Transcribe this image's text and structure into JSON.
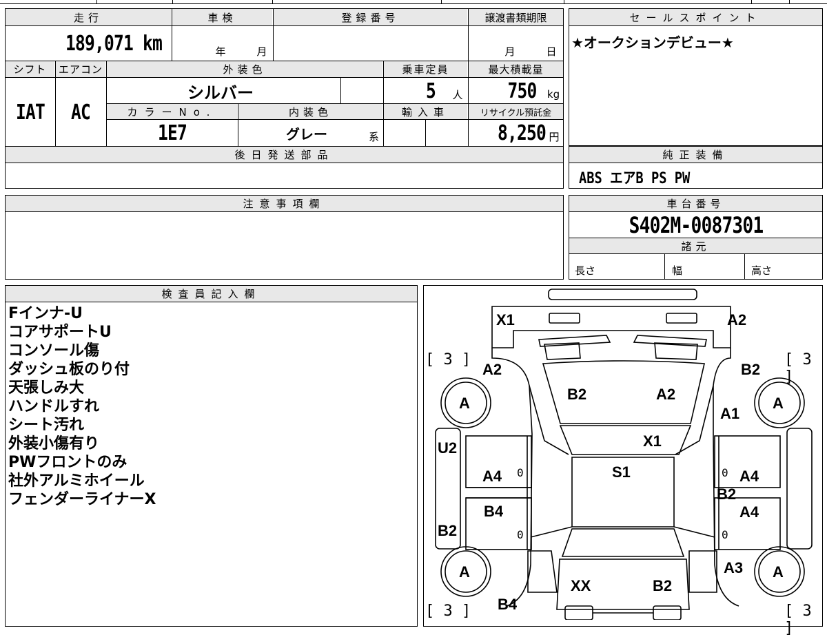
{
  "vehicle": {
    "mileage_label": "走行",
    "mileage_value": "189,071 km",
    "inspection_label": "車検",
    "inspection_year": "年",
    "inspection_month": "月",
    "registration_label": "登録番号",
    "registration_value": "",
    "transfer_label": "譲渡書類期限",
    "transfer_month": "月",
    "transfer_day": "日",
    "shift_label": "シフト",
    "shift_value": "IAT",
    "aircon_label": "エアコン",
    "aircon_value": "AC",
    "exterior_label": "外装色",
    "exterior_value": "シルバー",
    "capacity_label": "乗車定員",
    "capacity_value": "5",
    "capacity_unit": "人",
    "maxload_label": "最大積載量",
    "maxload_value": "750",
    "maxload_unit": "kg",
    "colorno_label": "カラーNo.",
    "colorno_value": "1E7",
    "interior_label": "内装色",
    "interior_value": "グレー",
    "interior_suffix": "系",
    "import_label": "輸入車",
    "recycle_label": "リサイクル預託金",
    "recycle_value": "8,250",
    "recycle_unit": "円",
    "later_parts_label": "後日発送部品"
  },
  "sales": {
    "label": "セールスポイント",
    "text": "★オークションデビュー★"
  },
  "equipment": {
    "label": "純正装備",
    "text": "ABS エアB PS PW"
  },
  "caution": {
    "label": "注意事項欄"
  },
  "chassis": {
    "label": "車台番号",
    "value": "S402M-0087301",
    "specs_label": "諸元",
    "length_label": "長さ",
    "width_label": "幅",
    "height_label": "高さ"
  },
  "inspector": {
    "label": "検査員記入欄",
    "notes": [
      "Fインナ-U",
      "コアサポートU",
      "コンソール傷",
      "ダッシュ板のり付",
      "天張しみ大",
      "ハンドルすれ",
      "シート汚れ",
      "外装小傷有り",
      "PWフロントのみ",
      "社外アルミホイール",
      "フェンダーライナーX"
    ]
  },
  "diagram": {
    "labels": {
      "front_left": "X1",
      "front_right": "A2",
      "fender_left": "A2",
      "fender_right": "B2",
      "hood_left": "B2",
      "hood_right": "A2",
      "fender_right_lower": "A1",
      "windshield": "X1",
      "pillar_left": "U2",
      "roof": "S1",
      "door_fl": "A4",
      "door_fr": "A4",
      "sill_right": "B2",
      "door_rl": "B4",
      "door_rr": "A4",
      "pillar_left_rear": "B2",
      "quarter_right": "A3",
      "rear_glass": "XX",
      "trunk_right": "B2",
      "rear_left": "B4",
      "zero_1": "0",
      "zero_2": "0",
      "zero_3": "0",
      "zero_4": "0"
    },
    "tire_label": "A",
    "tire_tread": "3"
  }
}
